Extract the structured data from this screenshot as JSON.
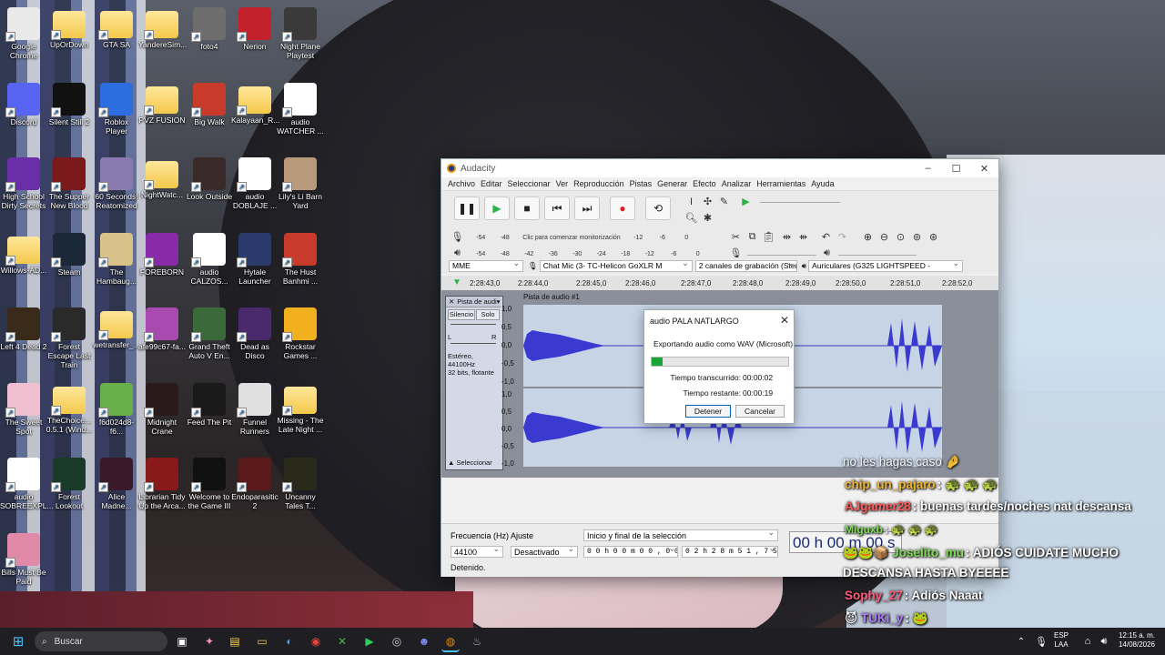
{
  "desktop": {
    "icons": [
      {
        "label": "Google Chrome",
        "color": "#e9e9e9"
      },
      {
        "label": "UpOrDown",
        "color": "folder"
      },
      {
        "label": "GTA SA",
        "color": "folder"
      },
      {
        "label": "YandereSim...",
        "color": "folder"
      },
      {
        "label": "foto4",
        "color": "#6d6d6d"
      },
      {
        "label": "Nerion",
        "color": "#c3212b"
      },
      {
        "label": "Night Plane Playtest",
        "color": "#3a3a3a"
      },
      {
        "label": "Discord",
        "color": "#5865f2"
      },
      {
        "label": "Silent Still 2",
        "color": "#111111"
      },
      {
        "label": "Roblox Player",
        "color": "#2c6de0"
      },
      {
        "label": "PVZ FUSION",
        "color": "folder"
      },
      {
        "label": "Big Walk",
        "color": "#c83a2a"
      },
      {
        "label": "Kalayaan_R...",
        "color": "folder"
      },
      {
        "label": "audio WATCHER ...",
        "color": "#ffffff"
      },
      {
        "label": "High School Dirty Secrets",
        "color": "#6a2fa8"
      },
      {
        "label": "The Supper New Blood",
        "color": "#7a1a1a"
      },
      {
        "label": "60 Seconds! Reatomized",
        "color": "#8a7ab0"
      },
      {
        "label": "NightWatc...",
        "color": "folder"
      },
      {
        "label": "Look Outside",
        "color": "#3a2a2a"
      },
      {
        "label": "audio DOBLAJE ...",
        "color": "#ffffff"
      },
      {
        "label": "Lily's Li Barn Yard",
        "color": "#b89a7a"
      },
      {
        "label": "Willows-AD...",
        "color": "folder"
      },
      {
        "label": "Steam",
        "color": "#1b2838"
      },
      {
        "label": "The Hambaug...",
        "color": "#d8c28a"
      },
      {
        "label": "FOREBORN",
        "color": "#8a2aa8"
      },
      {
        "label": "audio CALZOS...",
        "color": "#ffffff"
      },
      {
        "label": "Hytale Launcher",
        "color": "#2a3a6a"
      },
      {
        "label": "The Hust Banhmi ...",
        "color": "#c83a2a"
      },
      {
        "label": "Left 4 Dead 2",
        "color": "#3a2a1a"
      },
      {
        "label": "Forest Escape Last Train",
        "color": "#2a2a2a"
      },
      {
        "label": "wetransfer_...",
        "color": "folder"
      },
      {
        "label": "afe99c67-fa...",
        "color": "#a84ab0"
      },
      {
        "label": "Grand Theft Auto V En...",
        "color": "#3a6a3a"
      },
      {
        "label": "Dead as Disco",
        "color": "#4a2a6a"
      },
      {
        "label": "Rockstar Games ...",
        "color": "#f2b01e"
      },
      {
        "label": "The Sweet Spot",
        "color": "#f0c0d0"
      },
      {
        "label": "TheChoice... 0.5.1 (Wind...",
        "color": "folder"
      },
      {
        "label": "f6d024d8-f6...",
        "color": "#6ab04a"
      },
      {
        "label": "Midnight Crane",
        "color": "#2a1a1a"
      },
      {
        "label": "Feed The Pit",
        "color": "#1a1a1a"
      },
      {
        "label": "Funnel Runners",
        "color": "#e0e0e0"
      },
      {
        "label": "Missing - The Late Night ...",
        "color": "folder"
      },
      {
        "label": "audio SOBREEXPL...",
        "color": "#ffffff"
      },
      {
        "label": "Forest Lookout",
        "color": "#1a3a2a"
      },
      {
        "label": "Alice Madne...",
        "color": "#3a1a2a"
      },
      {
        "label": "Librarian Tidy Up the Arca...",
        "color": "#8a1a1a"
      },
      {
        "label": "Welcome to the Game III",
        "color": "#111111"
      },
      {
        "label": "Endoparasitic 2",
        "color": "#5a1a1a"
      },
      {
        "label": "Uncanny Tales T...",
        "color": "#2a2a1a"
      },
      {
        "label": "Bills Must Be Paid",
        "color": "#e08aa8"
      }
    ]
  },
  "audacity": {
    "title": "Audacity",
    "menu": [
      "Archivo",
      "Editar",
      "Seleccionar",
      "Ver",
      "Reproducción",
      "Pistas",
      "Generar",
      "Efecto",
      "Analizar",
      "Herramientas",
      "Ayuda"
    ],
    "monitor_hint": "Clic para comenzar monitorización",
    "meter_rec": [
      "-54",
      "-48",
      "",
      "-12",
      "-6",
      "0"
    ],
    "meter_play": [
      "-54",
      "-48",
      "-42",
      "-36",
      "-30",
      "-24",
      "-18",
      "-12",
      "-6",
      "0"
    ],
    "host": "MME",
    "mic": "Chat Mic (3- TC-Helicon GoXLR M",
    "channels": "2 canales de grabación (Ster",
    "speaker": "Auriculares (G325 LIGHTSPEED -",
    "ruler": [
      "2:28:43,0",
      "2:28:44,0",
      "2:28:45,0",
      "2:28:46,0",
      "2:28:47,0",
      "2:28:48,0",
      "2:28:49,0",
      "2:28:50,0",
      "2:28:51,0",
      "2:28:52,0"
    ],
    "track": {
      "short_name": "Pista de audi",
      "name": "Pista de audio #1",
      "mute": "Silencio",
      "solo": "Solo",
      "info": "Estéreo, 44100Hz\n32 bits, flotante",
      "select": "Seleccionar",
      "scale_top": [
        "1,0",
        "0,5",
        "0,0",
        "-0,5",
        "-1,0"
      ],
      "scale_bottom": [
        "1,0",
        "0,5",
        "0,0",
        "-0,5",
        "-1,0"
      ]
    },
    "bottom": {
      "rate_label": "Frecuencia (Hz)",
      "snap_label": "Ajuste",
      "rate_value": "44100",
      "snap_value": "Desactivado",
      "selection_mode": "Inicio y final de la selección",
      "sel_start": "0 0 h 0 0 m 0 0 , 0 0 0 s",
      "sel_end": "0 2 h 2 8 m 5 1 , 7 5 9 s",
      "big_time": "00 h 00 m 00 s"
    },
    "status": "Detenido."
  },
  "dialog": {
    "title": "audio PALA NATLARGO",
    "message": "Exportando audio como WAV (Microsoft)",
    "progress": 0.08,
    "elapsed_label": "Tiempo transcurrido:",
    "elapsed_value": "00:00:02",
    "remaining_label": "Tiempo restante:",
    "remaining_value": "00:00:19",
    "stop_label": "Detener",
    "cancel_label": "Cancelar"
  },
  "chat": [
    {
      "user": "",
      "text": "no les hagas caso",
      "user_color": "#ffffff",
      "faded": true
    },
    {
      "user": "chip_un_pajaro",
      "text": ":",
      "user_color": "#f0b429"
    },
    {
      "user": "AJgamer28",
      "text": ": buenas tardes/noches nat descansa",
      "user_color": "#ff5a5a"
    },
    {
      "user": "Miguxb",
      "text": ":",
      "user_color": "#7ed957"
    },
    {
      "user": "Joselito_mu",
      "text": ": ADIÓS CUIDATE MUCHO",
      "user_color": "#7ed957"
    },
    {
      "user": "",
      "text": "DESCANSA HASTA BYEEEE",
      "user_color": "#ffffff"
    },
    {
      "user": "Sophy_27",
      "text": ": Adiós Naaat",
      "user_color": "#ff5a7a"
    },
    {
      "user": "TUKi_y",
      "text": ":",
      "user_color": "#b07aff"
    }
  ],
  "taskbar": {
    "search": "Buscar",
    "lang": "ESP",
    "lang2": "LAA",
    "time": "12:15 a. m.",
    "date": "14/08/2026"
  }
}
